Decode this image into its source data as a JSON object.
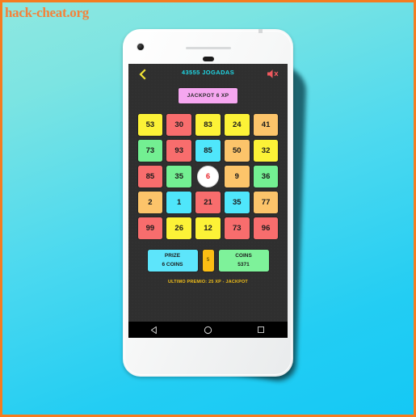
{
  "watermark": "hack-cheat.org",
  "app": {
    "header": {
      "title": "43555 JOGADAS",
      "back_icon": "back-chevron-icon",
      "mute_icon": "speaker-mute-icon",
      "title_color": "#1fd8e6",
      "back_color": "#f2e335",
      "mute_color": "#f0595e"
    },
    "jackpot_button": {
      "label": "JACKPOT 6 XP",
      "color": "#f6a7f0"
    },
    "grid": {
      "rows": 5,
      "cols": 5,
      "cells": [
        {
          "value": "53",
          "color": "#fcf237"
        },
        {
          "value": "30",
          "color": "#f86d6d"
        },
        {
          "value": "83",
          "color": "#fcf237"
        },
        {
          "value": "24",
          "color": "#fcf237"
        },
        {
          "value": "41",
          "color": "#fcc46a"
        },
        {
          "value": "73",
          "color": "#73ef92"
        },
        {
          "value": "93",
          "color": "#f86d6d"
        },
        {
          "value": "85",
          "color": "#4fe6fb"
        },
        {
          "value": "50",
          "color": "#fcc46a"
        },
        {
          "value": "32",
          "color": "#fcf237"
        },
        {
          "value": "85",
          "color": "#f86d6d"
        },
        {
          "value": "35",
          "color": "#73ef92"
        },
        {
          "value": "6",
          "color": "#ffffff",
          "ball": true
        },
        {
          "value": "9",
          "color": "#fcc46a"
        },
        {
          "value": "36",
          "color": "#73ef92"
        },
        {
          "value": "2",
          "color": "#fcc46a"
        },
        {
          "value": "1",
          "color": "#4fe6fb"
        },
        {
          "value": "21",
          "color": "#f86d6d"
        },
        {
          "value": "35",
          "color": "#4fe6fb"
        },
        {
          "value": "77",
          "color": "#fcc46a"
        },
        {
          "value": "99",
          "color": "#f86d6d"
        },
        {
          "value": "26",
          "color": "#fcf237"
        },
        {
          "value": "12",
          "color": "#fcf237"
        },
        {
          "value": "73",
          "color": "#f86d6d"
        },
        {
          "value": "96",
          "color": "#f86d6d"
        }
      ]
    },
    "panels": {
      "prize": {
        "line1": "PRIZE",
        "line2": "6 COINS",
        "color": "#5de5fb"
      },
      "spin": {
        "label": "5",
        "color": "#fcbe14"
      },
      "coins": {
        "line1": "COINS",
        "line2": "5371",
        "color": "#7ef29a"
      }
    },
    "last_prize": "ULTIMO PREMIO: 25 XP - JACKPOT"
  },
  "navbar": {
    "back": "back-triangle-icon",
    "home": "home-circle-icon",
    "recents": "recents-square-icon"
  }
}
